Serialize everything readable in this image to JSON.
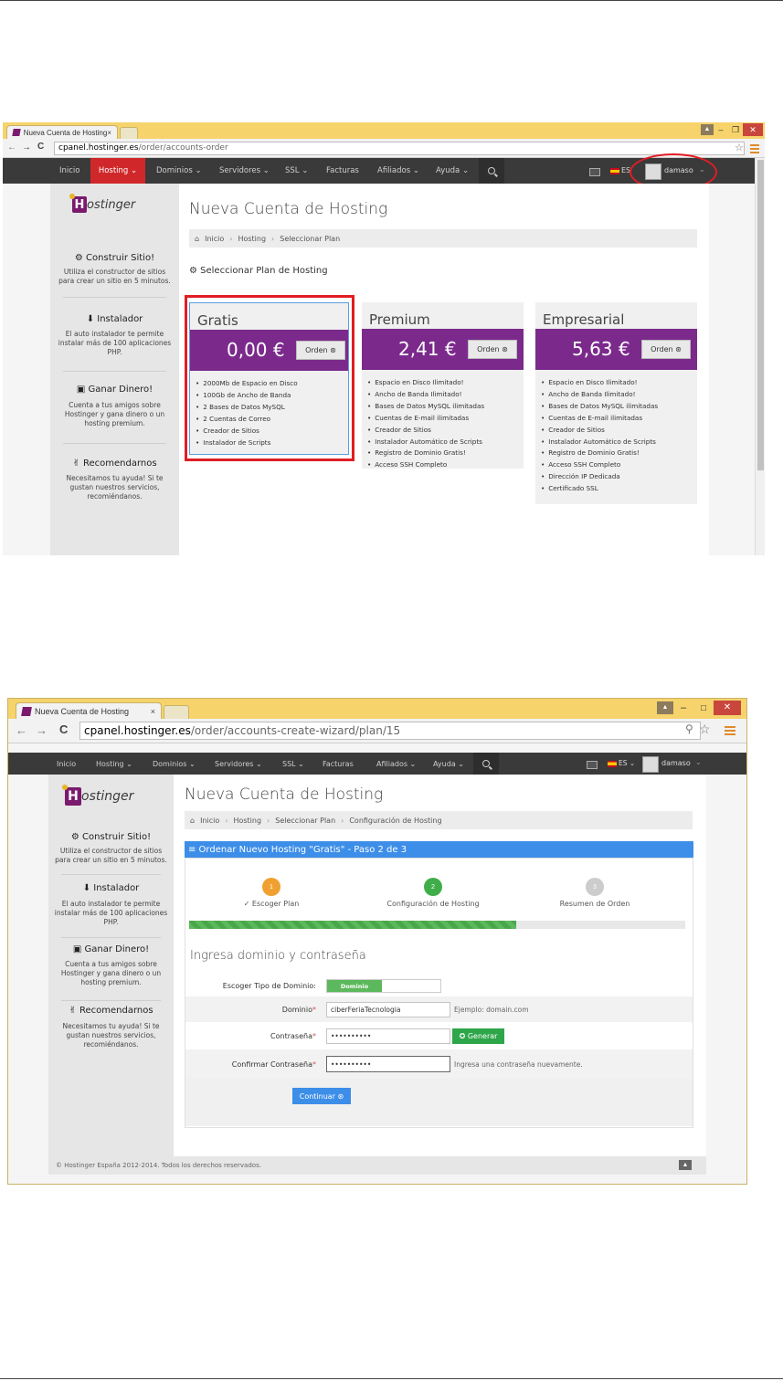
{
  "brand_color": "#7b2a8c",
  "accent_red": "#d0282a",
  "shot1": {
    "tab_title": "Nueva Cuenta de Hosting",
    "tab_close": "×",
    "url_host": "cpanel.hostinger.es",
    "url_path": "/order/accounts-order",
    "nav": [
      "Inicio",
      "Hosting ⌄",
      "Dominios ⌄",
      "Servidores ⌄",
      "SSL ⌄",
      "Facturas",
      "Afiliados ⌄",
      "Ayuda ⌄"
    ],
    "lang": "ES",
    "user": "damaso",
    "logo": "ostinger",
    "sidebar": [
      {
        "title": "Construir Sitio!",
        "text": "Utiliza el constructor de sitios para crear un sitio en 5 minutos."
      },
      {
        "title": "Instalador",
        "text": "El auto instalador te permite instalar más de 100 aplicaciones PHP."
      },
      {
        "title": "Ganar Dinero!",
        "text": "Cuenta a tus amigos sobre Hostinger y gana dinero o un hosting premium."
      },
      {
        "title": "Recomendarnos",
        "text": "Necesitamos tu ayuda! Si te gustan nuestros servicios, recomiéndanos."
      }
    ],
    "page_title": "Nueva Cuenta de Hosting",
    "breadcrumb": [
      "Inicio",
      "Hosting",
      "Seleccionar Plan"
    ],
    "section_title": "Seleccionar Plan de Hosting",
    "order_label": "Orden ⊛",
    "plans": [
      {
        "name": "Gratis",
        "price": "0,00 €",
        "features": [
          "2000Mb de Espacio en Disco",
          "100Gb de Ancho de Banda",
          "2 Bases de Datos MySQL",
          "2 Cuentas de Correo",
          "Creador de Sitios",
          "Instalador de Scripts"
        ]
      },
      {
        "name": "Premium",
        "price": "2,41 €",
        "features": [
          "Espacio en Disco Ilimitado!",
          "Ancho de Banda Ilimitado!",
          "Bases de Datos MySQL ilimitadas",
          "Cuentas de E-mail ilimitadas",
          "Creador de Sitios",
          "Instalador Automático de Scripts",
          "Registro de Dominio Gratis!",
          "Acceso SSH Completo"
        ]
      },
      {
        "name": "Empresarial",
        "price": "5,63 €",
        "features": [
          "Espacio en Disco Ilimitado!",
          "Ancho de Banda Ilimitado!",
          "Bases de Datos MySQL ilimitadas",
          "Cuentas de E-mail ilimitadas",
          "Creador de Sitios",
          "Instalador Automático de Scripts",
          "Registro de Dominio Gratis!",
          "Acceso SSH Completo",
          "Dirección IP Dedicada",
          "Certificado SSL"
        ]
      }
    ]
  },
  "shot2": {
    "tab_title": "Nueva Cuenta de Hosting",
    "tab_close": "×",
    "url_host": "cpanel.hostinger.es",
    "url_path": "/order/accounts-create-wizard/plan/15",
    "nav": [
      "Inicio",
      "Hosting ⌄",
      "Dominios ⌄",
      "Servidores ⌄",
      "SSL ⌄",
      "Facturas",
      "Afiliados ⌄",
      "Ayuda ⌄"
    ],
    "lang": "ES ⌄",
    "user": "damaso",
    "logo": "ostinger",
    "sidebar": [
      {
        "title": "Construir Sitio!",
        "text": "Utiliza el constructor de sitios para crear un sitio en 5 minutos."
      },
      {
        "title": "Instalador",
        "text": "El auto instalador te permite instalar más de 100 aplicaciones PHP."
      },
      {
        "title": "Ganar Dinero!",
        "text": "Cuenta a tus amigos sobre Hostinger y gana dinero o un hosting premium."
      },
      {
        "title": "Recomendarnos",
        "text": "Necesitamos tu ayuda! Si te gustan nuestros servicios, recomiéndanos."
      }
    ],
    "page_title": "Nueva Cuenta de Hosting",
    "breadcrumb": [
      "Inicio",
      "Hosting",
      "Seleccionar Plan",
      "Configuración de Hosting"
    ],
    "wizard_title": "≡ Ordenar Nuevo Hosting \"Gratis\" - Paso 2 de 3",
    "steps": [
      {
        "num": "1",
        "label": "✓ Escoger Plan",
        "color": "#f0a030"
      },
      {
        "num": "2",
        "label": "Configuración de Hosting",
        "color": "#3fae49"
      },
      {
        "num": "3",
        "label": "Resumen de Orden",
        "color": "#cccccc"
      }
    ],
    "progress_fraction": 0.66,
    "form_title": "Ingresa dominio y contraseña",
    "fields": {
      "domain_type_label": "Escoger Tipo de Dominio:",
      "domain_type_value": "Dominio",
      "domain_label": "Dominio",
      "domain_value": "ciberFeriaTecnologia",
      "domain_hint": "Ejemplo: domain.com",
      "password_label": "Contraseña",
      "password_value": "••••••••••",
      "generate_label": "✪ Generar",
      "confirm_label": "Confirmar Contraseña",
      "confirm_value": "••••••••••",
      "confirm_hint": "Ingresa una contraseña nuevamente."
    },
    "continue_label": "Continuar ⊛",
    "footer": "© Hostinger España 2012-2014. Todos los derechos reservados."
  }
}
